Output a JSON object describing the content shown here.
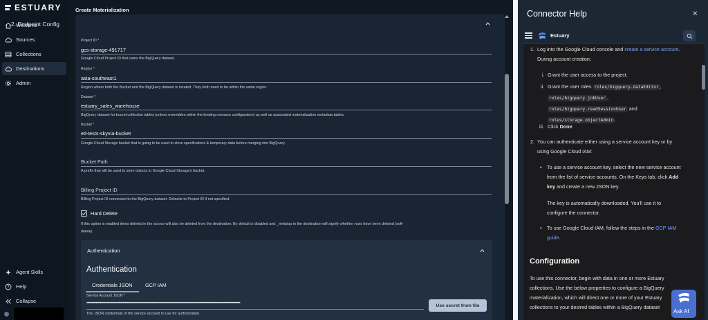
{
  "sidebar": {
    "brand": "ESTUARY",
    "items": [
      {
        "label": "Welcome",
        "icon": "home-icon"
      },
      {
        "label": "Sources",
        "icon": "cloud-upload-icon"
      },
      {
        "label": "Collections",
        "icon": "database-icon"
      },
      {
        "label": "Destinations",
        "icon": "cloud-download-icon"
      },
      {
        "label": "Admin",
        "icon": "gear-icon"
      }
    ],
    "bottom_items": [
      {
        "label": "Agent Skills",
        "icon": "sparkle-icon"
      },
      {
        "label": "Help",
        "icon": "help-icon"
      },
      {
        "label": "Collapse",
        "icon": "collapse-icon"
      }
    ]
  },
  "form": {
    "title": "Create Materialization",
    "section": "2. Endpoint Config",
    "fields": [
      {
        "label": "Project ID *",
        "value": "gcs-storage-491717",
        "help": "Google Cloud Project ID that owns the BigQuery dataset."
      },
      {
        "label": "Region *",
        "value": "asia-southeast1",
        "help": "Region where both the Bucket and the BigQuery dataset is located. They both need to be within the same region."
      },
      {
        "label": "Dataset *",
        "value": "estuary_sales_warehouse",
        "help": "BigQuery dataset for bound collection tables (unless overridden within the binding resource configuration) as well as associated materialization metadata tables."
      },
      {
        "label": "Bucket *",
        "value": "etl-tests-skyvia-bucket",
        "help": "Google Cloud Storage bucket that is going to be used to store specfications & temporary data before merging into BigQuery."
      }
    ],
    "bucket_path": {
      "placeholder": "Bucket Path",
      "help": "A prefix that will be used to store objects to Google Cloud Storage's bucket."
    },
    "billing_project": {
      "placeholder": "Billing Project ID",
      "help": "Billing Project ID connected to the BigQuery dataset. Defaults to Project ID if not specified."
    },
    "hard_delete": {
      "label": "Hard Delete",
      "checked": true,
      "help_line1": "If this option is enabled items deleted in the source will also be deleted from the destination. By default is disabled and _meta/op in the destination will signify whether rows have been deleted (soft-",
      "help_line2": "delete)."
    },
    "auth": {
      "header": "Authentication",
      "title": "Authentication",
      "tabs": [
        "Credentials JSON",
        "GCP IAM"
      ],
      "field_label": "Service Account JSON *",
      "masked_value": "••••••••••••••••••••••••••••••••••••••••••••••••••••••••••••••••••••••••••••••••••••••••••••••••••••••••••••••••••••••••••••••••••••••••••••••••••••",
      "button": "Use secret from file",
      "help": "The JSON credentials of the service account to use for authorization."
    }
  },
  "help": {
    "title": "Connector Help",
    "close": "✕",
    "doc_brand": "Estuary",
    "step1_a": "Log into the Google Cloud console and ",
    "step1_link": "create a service account",
    "step1_b": ".",
    "step1_c": "During account creation:",
    "sub_i": "Grant the user access to the project.",
    "sub_ii_a": "Grant the user roles ",
    "role1": "roles/bigquery.dataEditor",
    "role2": "roles/bigquery.jobUser",
    "role3": "roles/bigquery.readSessionUser",
    "and": " and",
    "role4": "roles/storage.objectAdmin",
    "sub_iii_a": "Click ",
    "sub_iii_b": "Done",
    "step2_a": "You can authenticate either using a service account key or by",
    "step2_b": "using Google Cloud IAM:",
    "bullet1_a": "To use a service account key, select the new service account",
    "bullet1_b": "from the list of service accounts. On the Keys tab, click ",
    "bullet1_bold": "Add",
    "bullet1_c": "key",
    "bullet1_d": " and create a new JSON key.",
    "bullet1_e": "The key is automatically downloaded. You'll use it to",
    "bullet1_f": "configure the connector.",
    "bullet2_a": "To use Google Cloud IAM, follow the steps in the ",
    "bullet2_link": "GCP IAM",
    "bullet2_link2": "guide",
    "bullet2_b": ".",
    "config_heading": "Configuration",
    "config_1": "To use this connector, begin with data in one or more Estuary",
    "config_2": "collections. Use the below properties to configure a BigQuery",
    "config_3": "materialization, which will direct one or more of your Estuary",
    "config_4": "collections to your desired tables within a BigQuery dataset",
    "ask_ai": "Ask AI"
  }
}
